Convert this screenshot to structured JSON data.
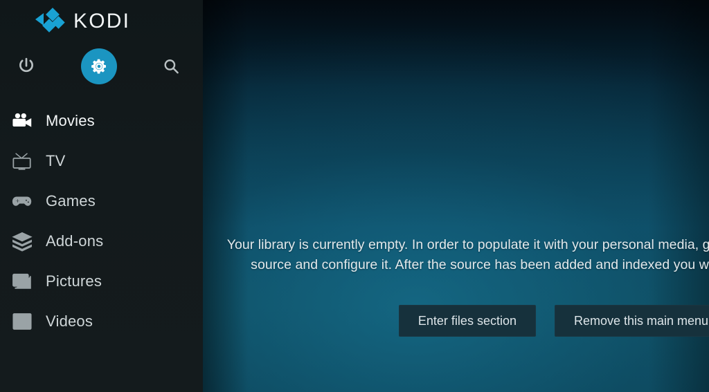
{
  "app": {
    "name": "KODI",
    "logo_icon": "kodi-logo-icon",
    "accent_color": "#19a2d4",
    "settings_circle_color": "#1b95c1",
    "sidebar_color": "#141b1d",
    "button_color": "#16313c"
  },
  "sidebar": {
    "quick_actions": [
      {
        "id": "power",
        "icon": "power-icon",
        "label": "Power"
      },
      {
        "id": "settings",
        "icon": "gear-icon",
        "label": "Settings",
        "selected": true
      },
      {
        "id": "search",
        "icon": "search-icon",
        "label": "Search"
      }
    ],
    "items": [
      {
        "label": "Movies",
        "icon": "movie-camera-icon",
        "active": true
      },
      {
        "label": "TV",
        "icon": "television-icon",
        "active": false
      },
      {
        "label": "Games",
        "icon": "gamepad-icon",
        "active": false
      },
      {
        "label": "Add-ons",
        "icon": "addons-box-icon",
        "active": false
      },
      {
        "label": "Pictures",
        "icon": "picture-icon",
        "active": false
      },
      {
        "label": "Videos",
        "icon": "film-strip-icon",
        "active": false
      }
    ]
  },
  "main": {
    "empty_message": "Your library is currently empty. In order to populate it with your personal media, go to the \"Files\" section, add a media source and configure it. After the source has been added and indexed you will be able to browse your library.",
    "buttons": [
      {
        "id": "enter-files",
        "label": "Enter files section"
      },
      {
        "id": "remove-menu-item",
        "label": "Remove this main menu item"
      }
    ]
  }
}
